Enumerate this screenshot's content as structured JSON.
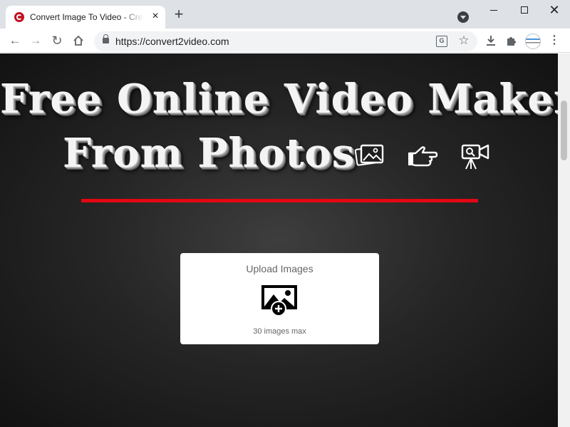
{
  "browser": {
    "tab": {
      "title": "Convert Image To Video - Create Video From Photos",
      "favicon": "convert2video-logo-icon"
    },
    "url": "https://convert2video.com",
    "accent_color": "#c1121f"
  },
  "hero": {
    "line1": "Free Online Video Maker",
    "line2": "From Photos",
    "icons": [
      "photos-icon",
      "pointer-hand-icon",
      "video-camera-icon"
    ],
    "rule_color": "#e30613"
  },
  "upload": {
    "title": "Upload Images",
    "icon": "add-image-icon",
    "limit": "30 images max"
  }
}
